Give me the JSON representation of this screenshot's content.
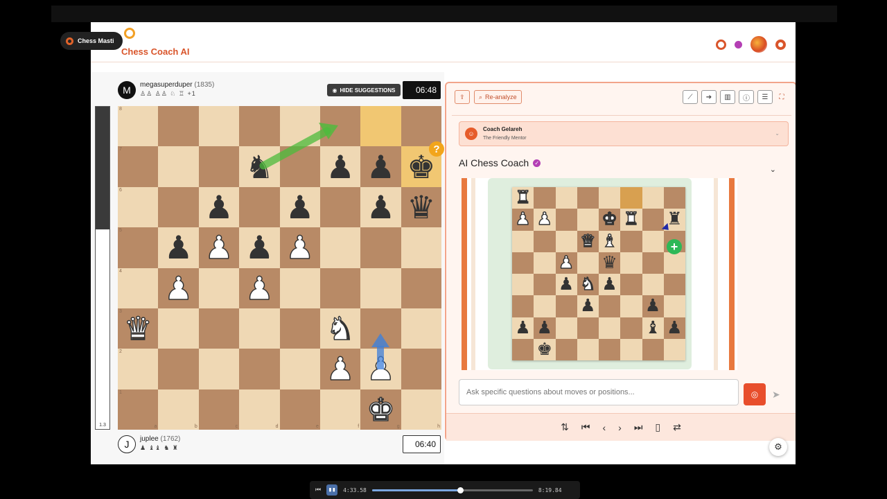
{
  "app": {
    "badge_label": "Chess Masti",
    "title": "Chess Coach AI"
  },
  "top_player": {
    "avatar_letter": "M",
    "name": "megasuperduper",
    "rating": "(1835)",
    "captured": "♙♙ ♙♙ ♘ ♖",
    "captured_extra": "+1",
    "clock": "06:48"
  },
  "bottom_player": {
    "avatar_letter": "J",
    "name": "juplee",
    "rating": "(1762)",
    "captured": "♟ ♝♝ ♞ ♜",
    "clock": "06:40"
  },
  "hide_suggestions_label": "HIDE SUGGESTIONS",
  "eval": {
    "value_label": "1.3",
    "black_fraction": 0.38
  },
  "board": {
    "ranks": [
      "8",
      "7",
      "6",
      "5",
      "4",
      "3",
      "2",
      "1"
    ],
    "files": [
      "a",
      "b",
      "c",
      "d",
      "e",
      "f",
      "g",
      "h"
    ],
    "highlight": [
      "g8",
      "h7"
    ],
    "pieces": {
      "d7": "bN",
      "f7": "bP",
      "g7": "bP",
      "h7": "bK",
      "c6": "bP",
      "e6": "bP",
      "g6": "bP",
      "h6": "bQ",
      "b5": "bP",
      "c5": "wP",
      "d5": "bP",
      "e5": "wP",
      "b4": "wP",
      "d4": "wP",
      "a3": "wQ",
      "f3": "wN",
      "f2": "wP",
      "g2": "wP",
      "g1": "wK"
    },
    "hint_symbol": "?"
  },
  "panel": {
    "reanalyze_label": "Re-analyze",
    "coach_name": "Coach Gelareh",
    "coach_subtitle": "The Friendly Mentor",
    "ai_title": "AI Chess Coach",
    "input_placeholder": "Ask specific questions about moves or positions..."
  },
  "mini_board": {
    "highlight": [
      "f8"
    ],
    "pieces": {
      "a8": "wR",
      "a7": "wP",
      "b7": "wP",
      "e7": "wK",
      "f7": "wR",
      "h7": "bR",
      "d6": "wQ",
      "e6": "wB",
      "c5": "wP",
      "e5": "bQ",
      "c4": "bP",
      "d4": "wN",
      "e4": "bP",
      "d3": "bP",
      "g3": "bP",
      "a2": "bP",
      "b2": "bP",
      "g2": "bB",
      "h2": "bP",
      "b1": "bK"
    }
  },
  "video": {
    "current_time": "4:33.58",
    "total_time": "8:19.84",
    "progress": 0.55
  }
}
